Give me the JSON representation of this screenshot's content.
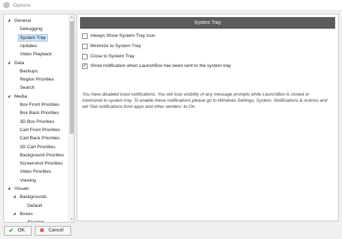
{
  "window": {
    "title": "Options"
  },
  "tree": [
    {
      "label": "General",
      "level": 0,
      "caret": "◢"
    },
    {
      "label": "Debugging",
      "level": 1
    },
    {
      "label": "System Tray",
      "level": 1,
      "selected": true
    },
    {
      "label": "Updates",
      "level": 1
    },
    {
      "label": "Video Playback",
      "level": 1
    },
    {
      "label": "Data",
      "level": 0,
      "caret": "◢"
    },
    {
      "label": "Backups",
      "level": 1
    },
    {
      "label": "Region Priorities",
      "level": 1
    },
    {
      "label": "Search",
      "level": 1
    },
    {
      "label": "Media",
      "level": 0,
      "caret": "◢"
    },
    {
      "label": "Box Front Priorities",
      "level": 1
    },
    {
      "label": "Box Back Priorities",
      "level": 1
    },
    {
      "label": "3D Box Priorities",
      "level": 1
    },
    {
      "label": "Cart Front Priorities",
      "level": 1
    },
    {
      "label": "Cart Back Priorities",
      "level": 1
    },
    {
      "label": "3D Cart Priorities",
      "level": 1
    },
    {
      "label": "Background Priorities",
      "level": 1
    },
    {
      "label": "Screenshot Priorities",
      "level": 1
    },
    {
      "label": "Video Priorities",
      "level": 1
    },
    {
      "label": "Viewing",
      "level": 1
    },
    {
      "label": "Visuals",
      "level": 0,
      "caret": "◢"
    },
    {
      "label": "Backgrounds",
      "level": 1,
      "caret": "◢"
    },
    {
      "label": "Default",
      "level": 2
    },
    {
      "label": "Boxes",
      "level": 1,
      "caret": "◢"
    },
    {
      "label": "Spacing",
      "level": 2
    }
  ],
  "panel": {
    "header": "System Tray",
    "options": [
      {
        "label": "Always Show System Tray Icon",
        "checked": false
      },
      {
        "label": "Minimize to System Tray",
        "checked": false
      },
      {
        "label": "Close to System Tray",
        "checked": false
      },
      {
        "label": "Show notification when LaunchBox has been sent to the system tray",
        "checked": true
      }
    ],
    "notice": "You have disabled toast notifications. You will lose visibility of any message prompts while LaunchBox is closed or minimized to system tray. To enable these notifications please go to Windows Settings, System, Notifications & Actions and set 'Get notifications from apps and other senders' to On."
  },
  "footer": {
    "ok_label": "OK",
    "cancel_label": "Cancel",
    "ok_icon": "check-icon",
    "cancel_icon": "cross-icon",
    "ok_icon_color": "#2e9e2e",
    "cancel_icon_color": "#d33b3b"
  },
  "colors": {
    "header_bg": "#5b5b5b",
    "selection_bg": "#cde3f7"
  }
}
